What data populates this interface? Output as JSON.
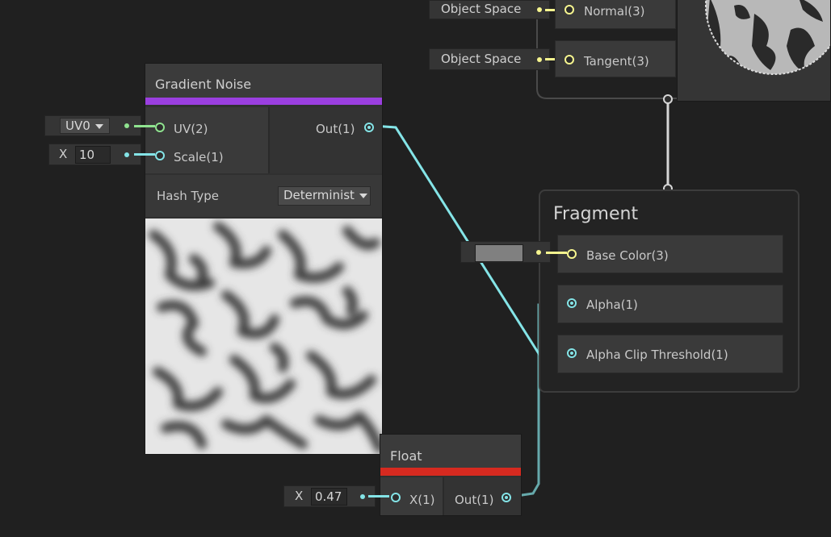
{
  "colors": {
    "vector2": "#8fe38f",
    "float": "#84e4e7",
    "vector3": "#f6f58f",
    "gradient_noise_accent": "#9b3fe0",
    "float_accent": "#d62a20",
    "wire_white": "#d6d6d6"
  },
  "top_nodes": {
    "normal_space": "Object Space",
    "normal_label": "Normal(3)",
    "tangent_space": "Object Space",
    "tangent_label": "Tangent(3)"
  },
  "gradient_noise": {
    "title": "Gradient Noise",
    "uv_input_value": "UV0",
    "uv_label": "UV(2)",
    "scale_axis": "X",
    "scale_value": "10",
    "scale_label": "Scale(1)",
    "out_label": "Out(1)",
    "hash_type_label": "Hash Type",
    "hash_type_value": "Determinist"
  },
  "fragment": {
    "title": "Fragment",
    "base_color_label": "Base Color(3)",
    "alpha_label": "Alpha(1)",
    "alpha_clip_label": "Alpha Clip Threshold(1)"
  },
  "float_node": {
    "title": "Float",
    "x_axis": "X",
    "x_value": "0.47",
    "x_label": "X(1)",
    "out_label": "Out(1)"
  }
}
